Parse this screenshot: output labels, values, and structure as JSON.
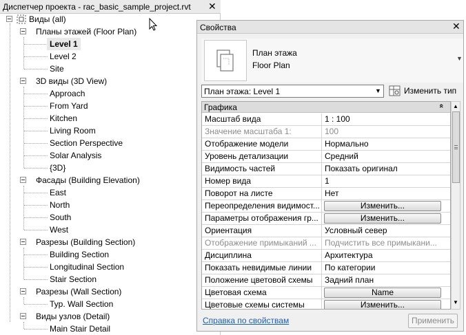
{
  "project_browser": {
    "title": "Диспетчер проекта - rac_basic_sample_project.rvt",
    "close_glyph": "✕",
    "root": "Виды (all)",
    "groups": [
      {
        "label": "Планы этажей (Floor Plan)",
        "items": [
          "Level 1",
          "Level 2",
          "Site"
        ],
        "selected": "Level 1"
      },
      {
        "label": "3D виды (3D View)",
        "items": [
          "Approach",
          "From Yard",
          "Kitchen",
          "Living Room",
          "Section Perspective",
          "Solar Analysis",
          "{3D}"
        ]
      },
      {
        "label": "Фасады (Building Elevation)",
        "items": [
          "East",
          "North",
          "South",
          "West"
        ]
      },
      {
        "label": "Разрезы (Building Section)",
        "items": [
          "Building Section",
          "Longitudinal Section",
          "Stair Section"
        ]
      },
      {
        "label": "Разрезы (Wall Section)",
        "items": [
          "Typ. Wall Section"
        ]
      },
      {
        "label": "Виды узлов (Detail)",
        "items": [
          "Main Stair Detail"
        ]
      }
    ]
  },
  "properties": {
    "title": "Свойства",
    "close_glyph": "✕",
    "type_selector": {
      "line1": "План этажа",
      "line2": "Floor Plan"
    },
    "instance_dropdown": "План этажа: Level 1",
    "edit_type_label": "Изменить тип",
    "group_header": "Графика",
    "collapse_glyph": "«",
    "rows": [
      {
        "name": "Масштаб вида",
        "value": "1 : 100"
      },
      {
        "name": "Значение масштаба    1:",
        "value": "100",
        "readonly": true
      },
      {
        "name": "Отображение модели",
        "value": "Нормально"
      },
      {
        "name": "Уровень детализации",
        "value": "Средний"
      },
      {
        "name": "Видимость частей",
        "value": "Показать оригинал"
      },
      {
        "name": "Номер вида",
        "value": "1"
      },
      {
        "name": "Поворот на листе",
        "value": "Нет"
      },
      {
        "name": "Переопределения видимост...",
        "value": "Изменить...",
        "button": true
      },
      {
        "name": "Параметры отображения гр...",
        "value": "Изменить...",
        "button": true
      },
      {
        "name": "Ориентация",
        "value": "Условный север"
      },
      {
        "name": "Отображение примыканий ...",
        "value": "Подчистить все примыкани...",
        "readonly": true
      },
      {
        "name": "Дисциплина",
        "value": "Архитектура"
      },
      {
        "name": "Показать невидимые линии",
        "value": "По категории"
      },
      {
        "name": "Положение цветовой схемы",
        "value": "Задний план"
      },
      {
        "name": "Цветовая схема",
        "value": "Name",
        "button": true
      },
      {
        "name": "Цветовые схемы системы",
        "value": "Изменить...",
        "button": true
      }
    ],
    "help_link": "Справка по свойствам",
    "apply_label": "Применить"
  }
}
